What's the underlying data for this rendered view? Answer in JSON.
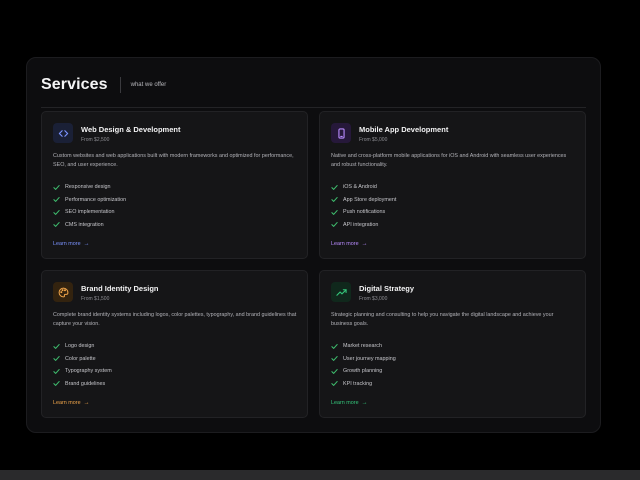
{
  "header": {
    "title": "Services",
    "subtitle": "what we offer"
  },
  "accents": {
    "blue": "#7b93ff",
    "purple": "#b98cff",
    "amber": "#f0a54a",
    "green": "#34c77b",
    "check": "#3fbf6f"
  },
  "cards": [
    {
      "icon": "code-icon",
      "title": "Web Design & Development",
      "price": "From $2,500",
      "description": "Custom websites and web applications built with modern frameworks and optimized for performance, SEO, and user experience.",
      "features": [
        "Responsive design",
        "Performance optimization",
        "SEO implementation",
        "CMS integration"
      ],
      "link": "Learn more"
    },
    {
      "icon": "phone-icon",
      "title": "Mobile App Development",
      "price": "From $5,000",
      "description": "Native and cross-platform mobile applications for iOS and Android with seamless user experiences and robust functionality.",
      "features": [
        "iOS & Android",
        "App Store deployment",
        "Push notifications",
        "API integration"
      ],
      "link": "Learn more"
    },
    {
      "icon": "palette-icon",
      "title": "Brand Identity Design",
      "price": "From $1,500",
      "description": "Complete brand identity systems including logos, color palettes, typography, and brand guidelines that capture your vision.",
      "features": [
        "Logo design",
        "Color palette",
        "Typography system",
        "Brand guidelines"
      ],
      "link": "Learn more"
    },
    {
      "icon": "trend-up-icon",
      "title": "Digital Strategy",
      "price": "From $3,000",
      "description": "Strategic planning and consulting to help you navigate the digital landscape and achieve your business goals.",
      "features": [
        "Market research",
        "User journey mapping",
        "Growth planning",
        "KPI tracking"
      ],
      "link": "Learn more"
    }
  ]
}
